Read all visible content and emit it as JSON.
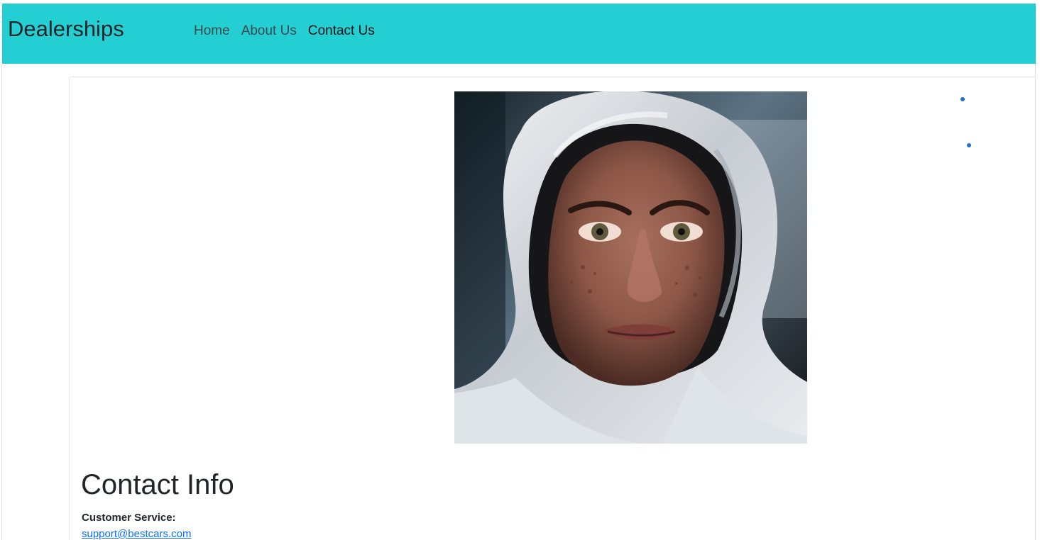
{
  "navbar": {
    "brand": "Dealerships",
    "links": [
      {
        "label": "Home",
        "active": false
      },
      {
        "label": "About Us",
        "active": false
      },
      {
        "label": "Contact Us",
        "active": true
      }
    ],
    "background_color": "#23cfd2"
  },
  "main": {
    "image": {
      "semantic": "portrait of a woman wearing a white hood"
    },
    "contact": {
      "title": "Contact Info",
      "customer_service_label": "Customer Service:",
      "customer_service_email": "support@bestcars.com"
    }
  },
  "colors": {
    "link": "#0d6efd",
    "text": "#212529"
  }
}
